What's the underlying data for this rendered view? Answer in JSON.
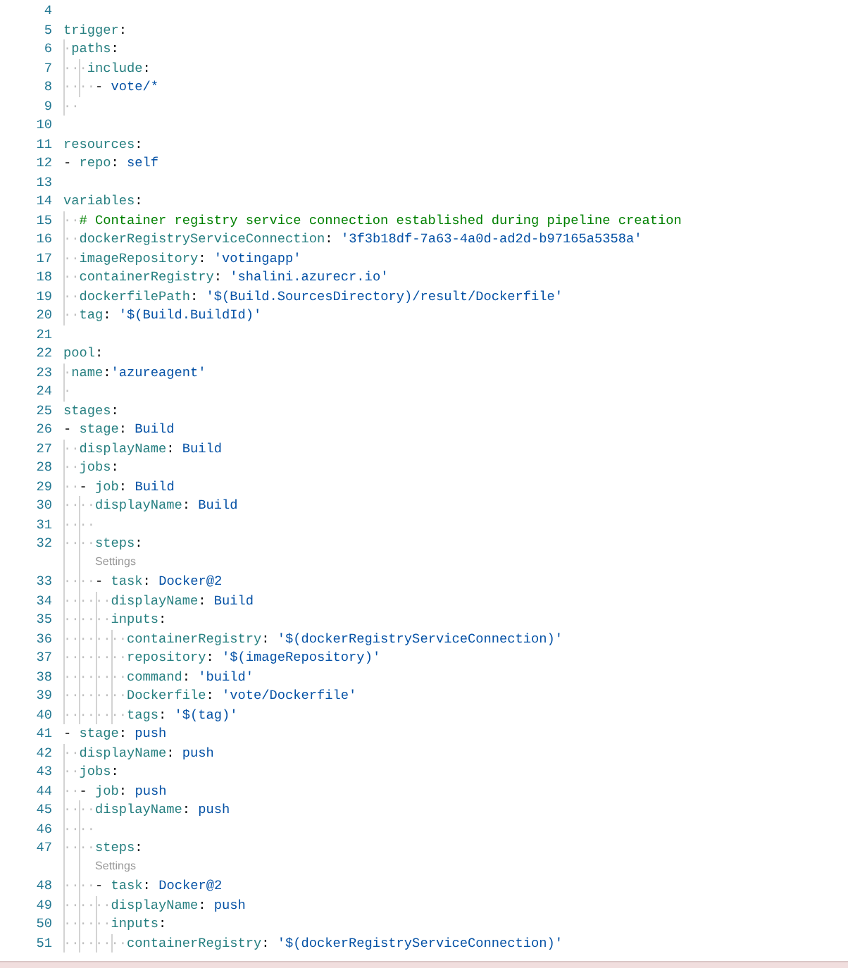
{
  "editor": {
    "lines": [
      {
        "kind": "code",
        "number": "4"
      },
      {
        "kind": "code",
        "number": "5",
        "tokens": [
          {
            "kind": "key",
            "text": "trigger"
          },
          {
            "kind": "punct",
            "text": ":"
          }
        ]
      },
      {
        "kind": "code",
        "number": "6",
        "tokens": [
          {
            "kind": "indent",
            "text": "·"
          },
          {
            "kind": "key",
            "text": "paths"
          },
          {
            "kind": "punct",
            "text": ":"
          }
        ]
      },
      {
        "kind": "code",
        "number": "7",
        "tokens": [
          {
            "kind": "indent",
            "text": "···"
          },
          {
            "kind": "key",
            "text": "include"
          },
          {
            "kind": "punct",
            "text": ":"
          }
        ]
      },
      {
        "kind": "code",
        "number": "8",
        "tokens": [
          {
            "kind": "indent",
            "text": "····"
          },
          {
            "kind": "punct",
            "text": "- "
          },
          {
            "kind": "value",
            "text": "vote/*"
          }
        ]
      },
      {
        "kind": "code",
        "number": "9",
        "tokens": [
          {
            "kind": "indent",
            "text": "··"
          }
        ]
      },
      {
        "kind": "code",
        "number": "10"
      },
      {
        "kind": "code",
        "number": "11",
        "tokens": [
          {
            "kind": "key",
            "text": "resources"
          },
          {
            "kind": "punct",
            "text": ":"
          }
        ]
      },
      {
        "kind": "code",
        "number": "12",
        "tokens": [
          {
            "kind": "punct",
            "text": "- "
          },
          {
            "kind": "key",
            "text": "repo"
          },
          {
            "kind": "punct",
            "text": ": "
          },
          {
            "kind": "value",
            "text": "self"
          }
        ]
      },
      {
        "kind": "code",
        "number": "13"
      },
      {
        "kind": "code",
        "number": "14",
        "tokens": [
          {
            "kind": "key",
            "text": "variables"
          },
          {
            "kind": "punct",
            "text": ":"
          }
        ]
      },
      {
        "kind": "code",
        "number": "15",
        "tokens": [
          {
            "kind": "indent",
            "text": "··"
          },
          {
            "kind": "comment",
            "text": "# Container registry service connection established during pipeline creation"
          }
        ]
      },
      {
        "kind": "code",
        "number": "16",
        "tokens": [
          {
            "kind": "indent",
            "text": "··"
          },
          {
            "kind": "key",
            "text": "dockerRegistryServiceConnection"
          },
          {
            "kind": "punct",
            "text": ": "
          },
          {
            "kind": "value",
            "text": "'3f3b18df-7a63-4a0d-ad2d-b97165a5358a'"
          }
        ]
      },
      {
        "kind": "code",
        "number": "17",
        "tokens": [
          {
            "kind": "indent",
            "text": "··"
          },
          {
            "kind": "key",
            "text": "imageRepository"
          },
          {
            "kind": "punct",
            "text": ": "
          },
          {
            "kind": "value",
            "text": "'votingapp'"
          }
        ]
      },
      {
        "kind": "code",
        "number": "18",
        "tokens": [
          {
            "kind": "indent",
            "text": "··"
          },
          {
            "kind": "key",
            "text": "containerRegistry"
          },
          {
            "kind": "punct",
            "text": ": "
          },
          {
            "kind": "value",
            "text": "'shalini.azurecr.io'"
          }
        ]
      },
      {
        "kind": "code",
        "number": "19",
        "tokens": [
          {
            "kind": "indent",
            "text": "··"
          },
          {
            "kind": "key",
            "text": "dockerfilePath"
          },
          {
            "kind": "punct",
            "text": ": "
          },
          {
            "kind": "value",
            "text": "'$(Build.SourcesDirectory)/result/Dockerfile'"
          }
        ]
      },
      {
        "kind": "code",
        "number": "20",
        "tokens": [
          {
            "kind": "indent",
            "text": "··"
          },
          {
            "kind": "key",
            "text": "tag"
          },
          {
            "kind": "punct",
            "text": ": "
          },
          {
            "kind": "value",
            "text": "'$(Build.BuildId)'"
          }
        ]
      },
      {
        "kind": "code",
        "number": "21"
      },
      {
        "kind": "code",
        "number": "22",
        "tokens": [
          {
            "kind": "key",
            "text": "pool"
          },
          {
            "kind": "punct",
            "text": ":"
          }
        ]
      },
      {
        "kind": "code",
        "number": "23",
        "tokens": [
          {
            "kind": "indent",
            "text": "·"
          },
          {
            "kind": "key",
            "text": "name"
          },
          {
            "kind": "punct",
            "text": ":"
          },
          {
            "kind": "value",
            "text": "'azureagent'"
          }
        ]
      },
      {
        "kind": "code",
        "number": "24",
        "tokens": [
          {
            "kind": "indent",
            "text": "·"
          }
        ]
      },
      {
        "kind": "code",
        "number": "25",
        "tokens": [
          {
            "kind": "key",
            "text": "stages"
          },
          {
            "kind": "punct",
            "text": ":"
          }
        ]
      },
      {
        "kind": "code",
        "number": "26",
        "tokens": [
          {
            "kind": "punct",
            "text": "- "
          },
          {
            "kind": "key",
            "text": "stage"
          },
          {
            "kind": "punct",
            "text": ": "
          },
          {
            "kind": "value",
            "text": "Build"
          }
        ]
      },
      {
        "kind": "code",
        "number": "27",
        "tokens": [
          {
            "kind": "indent",
            "text": "··"
          },
          {
            "kind": "key",
            "text": "displayName"
          },
          {
            "kind": "punct",
            "text": ": "
          },
          {
            "kind": "value",
            "text": "Build"
          }
        ]
      },
      {
        "kind": "code",
        "number": "28",
        "tokens": [
          {
            "kind": "indent",
            "text": "··"
          },
          {
            "kind": "key",
            "text": "jobs"
          },
          {
            "kind": "punct",
            "text": ":"
          }
        ]
      },
      {
        "kind": "code",
        "number": "29",
        "tokens": [
          {
            "kind": "indent",
            "text": "··"
          },
          {
            "kind": "punct",
            "text": "- "
          },
          {
            "kind": "key",
            "text": "job"
          },
          {
            "kind": "punct",
            "text": ": "
          },
          {
            "kind": "value",
            "text": "Build"
          }
        ]
      },
      {
        "kind": "code",
        "number": "30",
        "tokens": [
          {
            "kind": "indent",
            "text": "····"
          },
          {
            "kind": "key",
            "text": "displayName"
          },
          {
            "kind": "punct",
            "text": ": "
          },
          {
            "kind": "value",
            "text": "Build"
          }
        ]
      },
      {
        "kind": "code",
        "number": "31",
        "tokens": [
          {
            "kind": "indent",
            "text": "····"
          }
        ]
      },
      {
        "kind": "code",
        "number": "32",
        "tokens": [
          {
            "kind": "indent",
            "text": "····"
          },
          {
            "kind": "key",
            "text": "steps"
          },
          {
            "kind": "punct",
            "text": ":"
          }
        ]
      },
      {
        "kind": "codelens",
        "label": "Settings"
      },
      {
        "kind": "code",
        "number": "33",
        "tokens": [
          {
            "kind": "indent",
            "text": "····"
          },
          {
            "kind": "punct",
            "text": "- "
          },
          {
            "kind": "key",
            "text": "task"
          },
          {
            "kind": "punct",
            "text": ": "
          },
          {
            "kind": "value",
            "text": "Docker@2"
          }
        ]
      },
      {
        "kind": "code",
        "number": "34",
        "tokens": [
          {
            "kind": "indent",
            "text": "······"
          },
          {
            "kind": "key",
            "text": "displayName"
          },
          {
            "kind": "punct",
            "text": ": "
          },
          {
            "kind": "value",
            "text": "Build"
          }
        ]
      },
      {
        "kind": "code",
        "number": "35",
        "tokens": [
          {
            "kind": "indent",
            "text": "······"
          },
          {
            "kind": "key",
            "text": "inputs"
          },
          {
            "kind": "punct",
            "text": ":"
          }
        ]
      },
      {
        "kind": "code",
        "number": "36",
        "tokens": [
          {
            "kind": "indent",
            "text": "········"
          },
          {
            "kind": "key",
            "text": "containerRegistry"
          },
          {
            "kind": "punct",
            "text": ": "
          },
          {
            "kind": "value",
            "text": "'$(dockerRegistryServiceConnection)'"
          }
        ]
      },
      {
        "kind": "code",
        "number": "37",
        "tokens": [
          {
            "kind": "indent",
            "text": "········"
          },
          {
            "kind": "key",
            "text": "repository"
          },
          {
            "kind": "punct",
            "text": ": "
          },
          {
            "kind": "value",
            "text": "'$(imageRepository)'"
          }
        ]
      },
      {
        "kind": "code",
        "number": "38",
        "tokens": [
          {
            "kind": "indent",
            "text": "········"
          },
          {
            "kind": "key",
            "text": "command"
          },
          {
            "kind": "punct",
            "text": ": "
          },
          {
            "kind": "value",
            "text": "'build'"
          }
        ]
      },
      {
        "kind": "code",
        "number": "39",
        "tokens": [
          {
            "kind": "indent",
            "text": "········"
          },
          {
            "kind": "key",
            "text": "Dockerfile"
          },
          {
            "kind": "punct",
            "text": ": "
          },
          {
            "kind": "value",
            "text": "'vote/Dockerfile'"
          }
        ]
      },
      {
        "kind": "code",
        "number": "40",
        "tokens": [
          {
            "kind": "indent",
            "text": "········"
          },
          {
            "kind": "key",
            "text": "tags"
          },
          {
            "kind": "punct",
            "text": ": "
          },
          {
            "kind": "value",
            "text": "'$(tag)'"
          }
        ]
      },
      {
        "kind": "code",
        "number": "41",
        "tokens": [
          {
            "kind": "punct",
            "text": "- "
          },
          {
            "kind": "key",
            "text": "stage"
          },
          {
            "kind": "punct",
            "text": ": "
          },
          {
            "kind": "value",
            "text": "push"
          }
        ]
      },
      {
        "kind": "code",
        "number": "42",
        "tokens": [
          {
            "kind": "indent",
            "text": "··"
          },
          {
            "kind": "key",
            "text": "displayName"
          },
          {
            "kind": "punct",
            "text": ": "
          },
          {
            "kind": "value",
            "text": "push"
          }
        ]
      },
      {
        "kind": "code",
        "number": "43",
        "tokens": [
          {
            "kind": "indent",
            "text": "··"
          },
          {
            "kind": "key",
            "text": "jobs"
          },
          {
            "kind": "punct",
            "text": ":"
          }
        ]
      },
      {
        "kind": "code",
        "number": "44",
        "tokens": [
          {
            "kind": "indent",
            "text": "··"
          },
          {
            "kind": "punct",
            "text": "- "
          },
          {
            "kind": "key",
            "text": "job"
          },
          {
            "kind": "punct",
            "text": ": "
          },
          {
            "kind": "value",
            "text": "push"
          }
        ]
      },
      {
        "kind": "code",
        "number": "45",
        "tokens": [
          {
            "kind": "indent",
            "text": "····"
          },
          {
            "kind": "key",
            "text": "displayName"
          },
          {
            "kind": "punct",
            "text": ": "
          },
          {
            "kind": "value",
            "text": "push"
          }
        ]
      },
      {
        "kind": "code",
        "number": "46",
        "tokens": [
          {
            "kind": "indent",
            "text": "····"
          }
        ]
      },
      {
        "kind": "code",
        "number": "47",
        "tokens": [
          {
            "kind": "indent",
            "text": "····"
          },
          {
            "kind": "key",
            "text": "steps"
          },
          {
            "kind": "punct",
            "text": ":"
          }
        ]
      },
      {
        "kind": "codelens",
        "label": "Settings"
      },
      {
        "kind": "code",
        "number": "48",
        "tokens": [
          {
            "kind": "indent",
            "text": "····"
          },
          {
            "kind": "punct",
            "text": "- "
          },
          {
            "kind": "key",
            "text": "task"
          },
          {
            "kind": "punct",
            "text": ": "
          },
          {
            "kind": "value",
            "text": "Docker@2"
          }
        ]
      },
      {
        "kind": "code",
        "number": "49",
        "tokens": [
          {
            "kind": "indent",
            "text": "······"
          },
          {
            "kind": "key",
            "text": "displayName"
          },
          {
            "kind": "punct",
            "text": ": "
          },
          {
            "kind": "value",
            "text": "push"
          }
        ]
      },
      {
        "kind": "code",
        "number": "50",
        "tokens": [
          {
            "kind": "indent",
            "text": "······"
          },
          {
            "kind": "key",
            "text": "inputs"
          },
          {
            "kind": "punct",
            "text": ":"
          }
        ]
      },
      {
        "kind": "code",
        "number": "51",
        "tokens": [
          {
            "kind": "indent",
            "text": "········"
          },
          {
            "kind": "key",
            "text": "containerRegistry"
          },
          {
            "kind": "punct",
            "text": ": "
          },
          {
            "kind": "value",
            "text": "'$(dockerRegistryServiceConnection)'"
          }
        ]
      }
    ]
  }
}
